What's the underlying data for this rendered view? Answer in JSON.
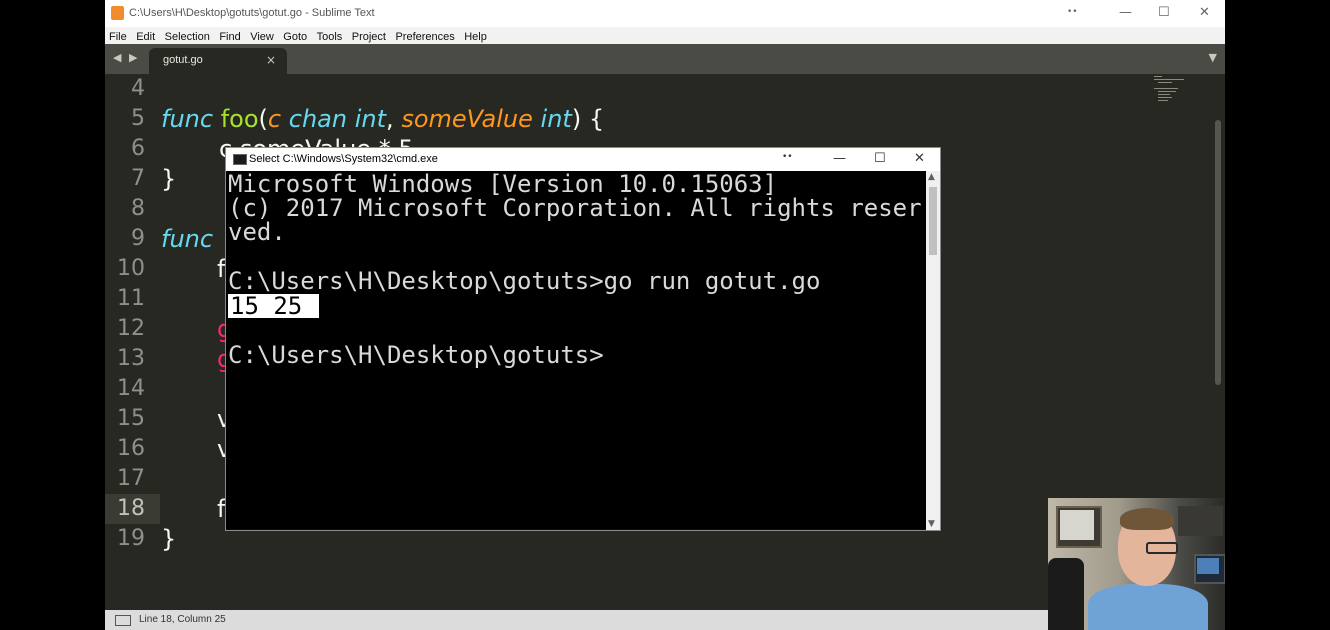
{
  "sublime": {
    "window_title": "C:\\Users\\H\\Desktop\\gotuts\\gotut.go - Sublime Text",
    "menu": [
      "File",
      "Edit",
      "Selection",
      "Find",
      "View",
      "Goto",
      "Tools",
      "Project",
      "Preferences",
      "Help"
    ],
    "tab": {
      "label": "gotut.go",
      "close": "×"
    },
    "nav_arrows": "◀ ▶",
    "dropdown": "▼",
    "line_numbers": [
      "4",
      "5",
      "6",
      "7",
      "8",
      "9",
      "10",
      "11",
      "12",
      "13",
      "14",
      "15",
      "16",
      "17",
      "18",
      "19"
    ],
    "code": {
      "l5_func": "func",
      "l5_name": "foo",
      "l5_open": "(",
      "l5_c": "c",
      "l5_chan": "chan",
      "l5_int1": "int",
      "l5_comma": ",",
      "l5_some": "someValue",
      "l5_int2": "int",
      "l5_close": ") {",
      "l6_partial": "c",
      "l6_rest": " someValue * 5",
      "l7": "}",
      "l9_func": "func",
      "l10": "f",
      "l12": "g",
      "l13": "g",
      "l15": "v",
      "l16": "v",
      "l18": "f",
      "l19": "}"
    },
    "status": "Line 18, Column 25"
  },
  "cmd": {
    "window_title": "Select C:\\Windows\\System32\\cmd.exe",
    "lines": [
      "Microsoft Windows [Version 10.0.15063]",
      "(c) 2017 Microsoft Corporation. All rights reser",
      "ved.",
      "C:\\Users\\H\\Desktop\\gotuts>go run gotut.go",
      "15 25 ",
      "C:\\Users\\H\\Desktop\\gotuts>"
    ]
  },
  "controls": {
    "minimize": "—",
    "maximize": "☐",
    "close": "✕",
    "restore_dots": "••"
  },
  "colors": {
    "editor_bg": "#272822",
    "keyword": "#66d9ef",
    "function": "#a6e22e",
    "param": "#fd971f",
    "red": "#f92672",
    "console_bg": "#000000"
  },
  "icons": [
    "sublime-app-icon",
    "cmd-app-icon",
    "status-panel-icon"
  ]
}
